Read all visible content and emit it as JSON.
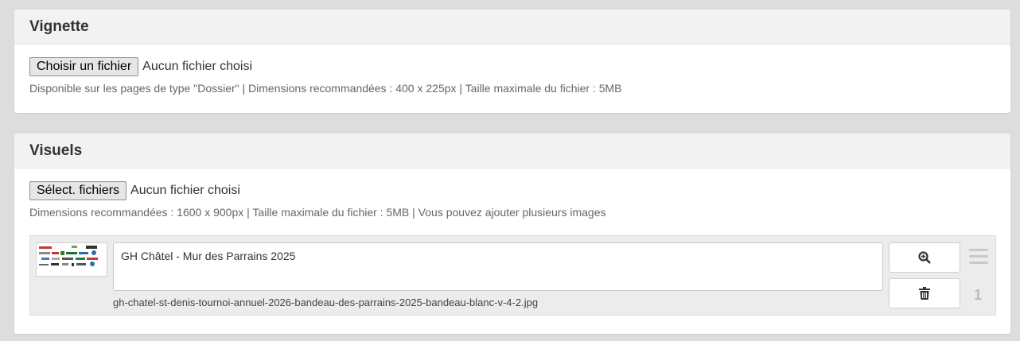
{
  "vignette": {
    "title": "Vignette",
    "file_button_label": "Choisir un fichier",
    "file_status": "Aucun fichier choisi",
    "hint": "Disponible sur les pages de type \"Dossier\" | Dimensions recommandées : 400 x 225px | Taille maximale du fichier : 5MB"
  },
  "visuels": {
    "title": "Visuels",
    "file_button_label": "Sélect. fichiers",
    "file_status": "Aucun fichier choisi",
    "hint": "Dimensions recommandées : 1600 x 900px | Taille maximale du fichier : 5MB | Vous pouvez ajouter plusieurs images",
    "items": [
      {
        "caption": "GH Châtel - Mur des Parrains 2025",
        "filename": "gh-chatel-st-denis-tournoi-annuel-2026-bandeau-des-parrains-2025-bandeau-blanc-v-4-2.jpg",
        "position": "1",
        "thumbnail_icon": "sponsor-logos-thumbnail",
        "zoom_icon": "zoom-in-icon",
        "delete_icon": "trash-icon",
        "handle_icon": "drag-handle-icon"
      }
    ]
  }
}
